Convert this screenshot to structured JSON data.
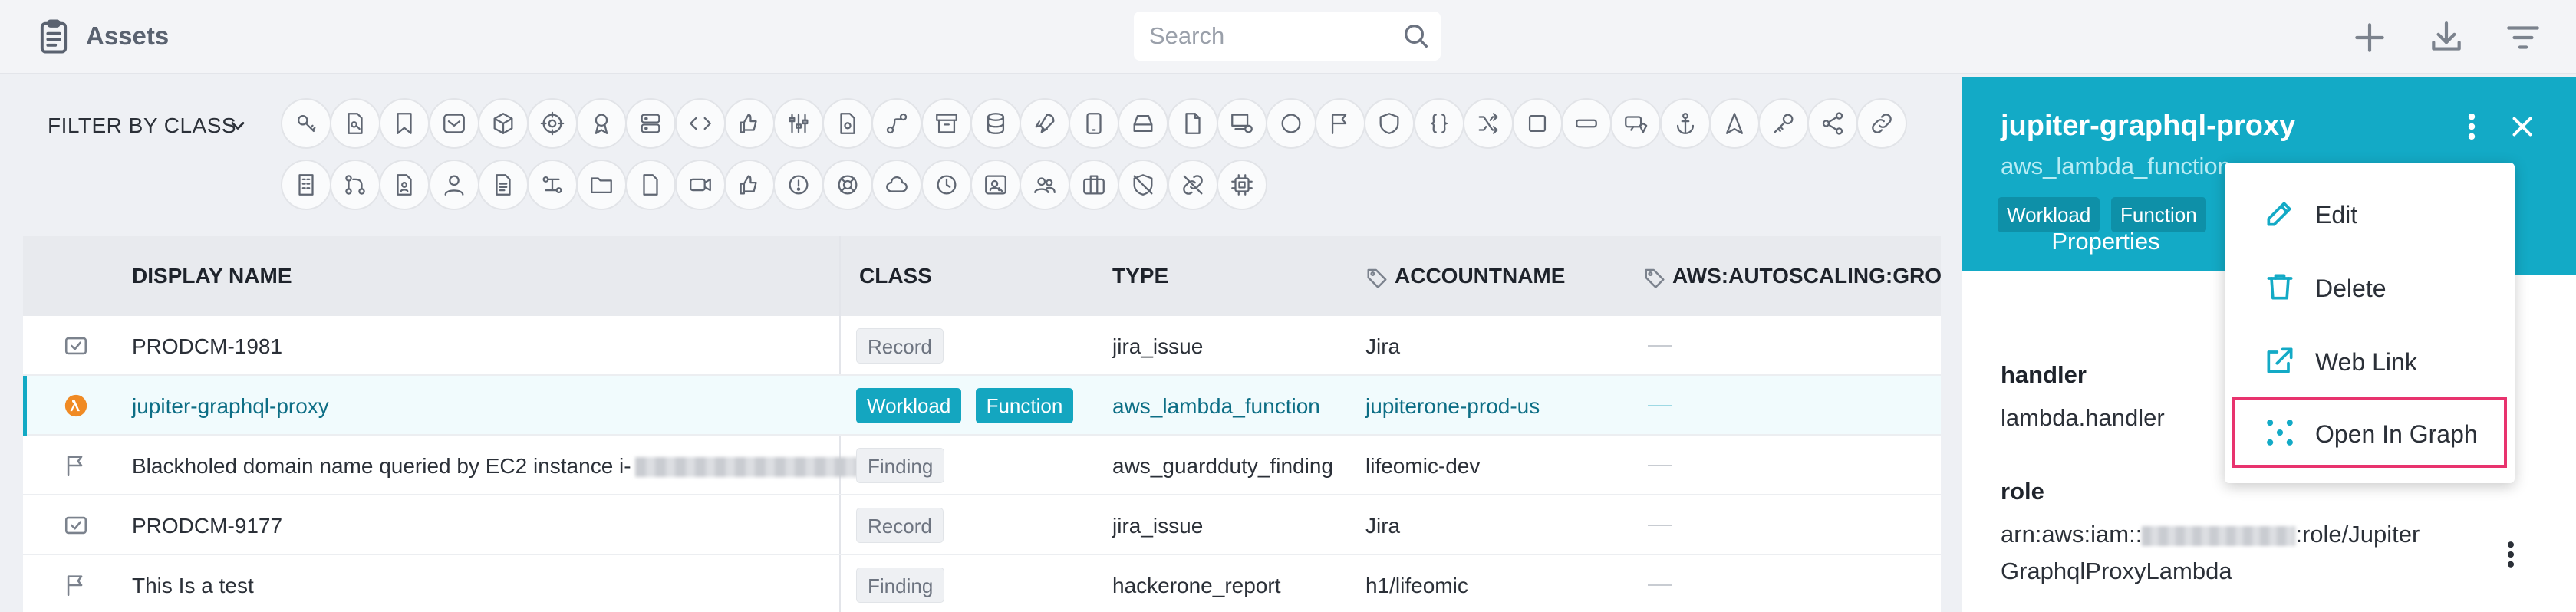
{
  "app": {
    "title": "Assets"
  },
  "search": {
    "placeholder": "Search"
  },
  "filter": {
    "label": "FILTER BY CLASS"
  },
  "class_icons": [
    "access-key-icon",
    "document-key-icon",
    "bookmark-icon",
    "inbox-icon",
    "cube-icon",
    "target-icon",
    "award-icon",
    "server-icon",
    "code-icon",
    "thumbs-network-icon",
    "sliders-icon",
    "document-settings-icon",
    "routing-icon",
    "archive-icon",
    "database-icon",
    "rocket-icon",
    "device-icon",
    "storage-icon",
    "file-icon",
    "network-settings-icon",
    "circle-icon",
    "flag-icon",
    "shield-icon",
    "braces-icon",
    "shuffle-icon",
    "square-icon",
    "minus-box-icon",
    "user-shield-icon",
    "anchor-icon",
    "navigation-icon",
    "key-icon",
    "share-icon",
    "link-icon",
    "building-icon",
    "git-icon",
    "document-user-icon",
    "user-icon",
    "notes-icon",
    "process-icon",
    "folder-icon",
    "blank-file-icon",
    "video-icon",
    "thumbs-up-icon",
    "alert-icon",
    "lifebuoy-icon",
    "cloud-icon",
    "clock-icon",
    "user-search-icon",
    "users-icon",
    "briefcase-icon",
    "shield-off-icon",
    "broken-link-icon",
    "chip-icon"
  ],
  "table": {
    "columns": [
      "DISPLAY NAME",
      "CLASS",
      "TYPE",
      "ACCOUNTNAME",
      "AWS:AUTOSCALING:GROU"
    ],
    "rows": [
      {
        "icon": "checkbox-icon",
        "name": "PRODCM-1981",
        "classes": [
          "Record"
        ],
        "type": "jira_issue",
        "account": "Jira",
        "selected": false
      },
      {
        "icon": "lambda-icon",
        "name": "jupiter-graphql-proxy",
        "classes": [
          "Workload",
          "Function"
        ],
        "type": "aws_lambda_function",
        "account": "jupiterone-prod-us",
        "selected": true
      },
      {
        "icon": "flag-icon",
        "name": "Blackholed domain name queried by EC2 instance i-",
        "classes": [
          "Finding"
        ],
        "type": "aws_guardduty_finding",
        "account": "lifeomic-dev",
        "selected": false
      },
      {
        "icon": "checkbox-icon",
        "name": "PRODCM-9177",
        "classes": [
          "Record"
        ],
        "type": "jira_issue",
        "account": "Jira",
        "selected": false
      },
      {
        "icon": "flag-icon",
        "name": "This Is a test",
        "classes": [
          "Finding"
        ],
        "type": "hackerone_report",
        "account": "h1/lifeomic",
        "selected": false
      }
    ]
  },
  "panel": {
    "title": "jupiter-graphql-proxy",
    "subtitle": "aws_lambda_function",
    "badges": [
      "Workload",
      "Function"
    ],
    "tab": "Properties",
    "props": [
      {
        "label": "handler",
        "value": "lambda.handler"
      },
      {
        "label": "role",
        "value_prefix": "arn:aws:iam::",
        "value_suffix": ":role/Jupiter",
        "value_line2": "GraphqlProxyLambda"
      }
    ]
  },
  "menu": {
    "items": [
      {
        "label": "Edit",
        "icon": "edit-icon"
      },
      {
        "label": "Delete",
        "icon": "trash-icon"
      },
      {
        "label": "Web Link",
        "icon": "external-link-icon"
      },
      {
        "label": "Open In Graph",
        "icon": "graph-icon"
      }
    ]
  },
  "colors": {
    "accent": "#13aac6",
    "badge": "#14a6c0",
    "highlight": "#e8336e"
  }
}
